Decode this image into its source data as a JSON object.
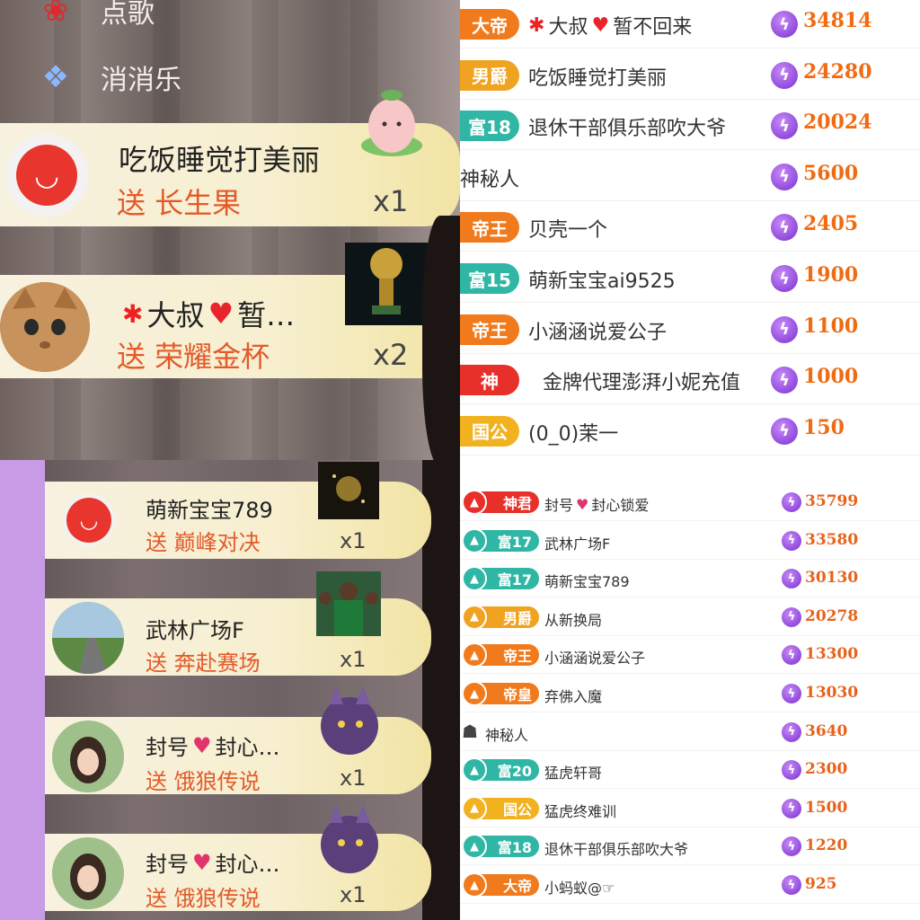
{
  "stream_top": {
    "menu": [
      {
        "label": "点歌",
        "icon": "rose-icon"
      },
      {
        "label": "消消乐",
        "icon": "crystal-icon"
      }
    ],
    "gifts": [
      {
        "user": "吃饭睡觉打美丽",
        "action": "送 长生果",
        "count": "x1",
        "avatar": "face-avatar-icon",
        "gift": "peach-icon"
      },
      {
        "user": "大叔",
        "user_suffix": "暂…",
        "action": "送 荣耀金杯",
        "count": "x2",
        "avatar": "cat-avatar",
        "gift": "trophy-icon"
      }
    ]
  },
  "stream_bot": {
    "gifts": [
      {
        "user": "萌新宝宝789",
        "action": "送 巅峰对决",
        "count": "x1",
        "gift": "stadium-icon"
      },
      {
        "user": "武林广场F",
        "action": "送 奔赴赛场",
        "count": "x1",
        "gift": "football-team-icon"
      },
      {
        "user": "封号",
        "user_suffix": "封心…",
        "action": "送 饿狼传说",
        "count": "x1",
        "gift": "wolf-icon"
      },
      {
        "user": "封号",
        "user_suffix": "封心…",
        "action": "送 饿狼传说",
        "count": "x1",
        "gift": "wolf-icon"
      }
    ]
  },
  "rank_top": {
    "rows": [
      {
        "badge": "大帝",
        "badge_color": "#f07a1c",
        "name": "大叔",
        "name_suffix": "暂不回来",
        "score": "34814"
      },
      {
        "badge": "男爵",
        "badge_color": "#f0a320",
        "name": "吃饭睡觉打美丽",
        "score": "24280"
      },
      {
        "badge": "富18",
        "badge_color": "#2fb6a4",
        "name": "退休干部俱乐部吹大爷",
        "score": "20024"
      },
      {
        "badge": "",
        "badge_color": "",
        "name": "神秘人",
        "score": "5600"
      },
      {
        "badge": "帝王",
        "badge_color": "#f07a1c",
        "name": "贝壳一个",
        "score": "2405"
      },
      {
        "badge": "富15",
        "badge_color": "#2fb6a4",
        "name": "萌新宝宝ai9525",
        "score": "1900"
      },
      {
        "badge": "帝王",
        "badge_color": "#f07a1c",
        "name": "小涵涵说爱公子",
        "score": "1100"
      },
      {
        "badge": "神",
        "badge_color": "#e8302a",
        "name": "金牌代理澎湃小妮充值",
        "score": "1000"
      },
      {
        "badge": "国公",
        "badge_color": "#f2b21f",
        "name": "(0_0)茉一",
        "score": "150"
      }
    ]
  },
  "rank_bot": {
    "rows": [
      {
        "badge": "神君",
        "badge_color": "#e8302a",
        "name": "封号",
        "name_suffix": "封心锁爱",
        "score": "35799"
      },
      {
        "badge": "富17",
        "badge_color": "#2fb6a4",
        "name": "武林广场F",
        "score": "33580"
      },
      {
        "badge": "富17",
        "badge_color": "#2fb6a4",
        "name": "萌新宝宝789",
        "score": "30130"
      },
      {
        "badge": "男爵",
        "badge_color": "#f0a320",
        "name": "从新换局",
        "score": "20278"
      },
      {
        "badge": "帝王",
        "badge_color": "#f07a1c",
        "name": "小涵涵说爱公子",
        "score": "13300"
      },
      {
        "badge": "帝皇",
        "badge_color": "#f07a1c",
        "name": "弃佛入魔",
        "score": "13030"
      },
      {
        "badge": "",
        "badge_color": "",
        "name": "神秘人",
        "score": "3640"
      },
      {
        "badge": "富20",
        "badge_color": "#2fb6a4",
        "name": "猛虎轩哥",
        "score": "2300"
      },
      {
        "badge": "国公",
        "badge_color": "#f2b21f",
        "name": "猛虎终难训",
        "score": "1500"
      },
      {
        "badge": "富18",
        "badge_color": "#2fb6a4",
        "name": "退休干部俱乐部吹大爷",
        "score": "1220"
      },
      {
        "badge": "大帝",
        "badge_color": "#f07a1c",
        "name": "小蚂蚁@☞",
        "score": "925"
      }
    ]
  }
}
